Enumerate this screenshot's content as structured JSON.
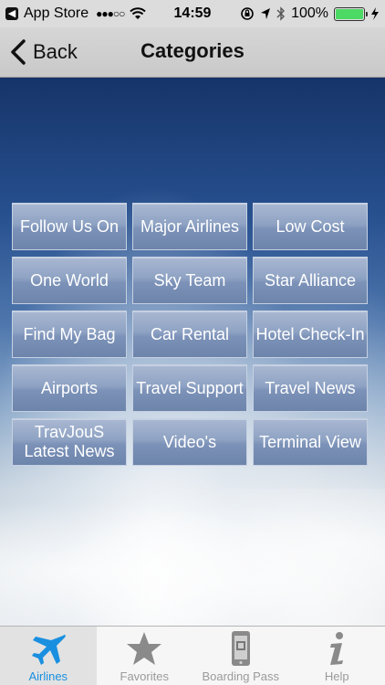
{
  "status_bar": {
    "back_glyph": "◀",
    "carrier": "App Store",
    "signal": "●●●○○",
    "time": "14:59",
    "battery_percent": "100%",
    "battery_level": 1.0,
    "battery_color": "#4cd964"
  },
  "nav": {
    "back_label": "Back",
    "title": "Categories"
  },
  "categories": [
    {
      "label": "Follow Us On"
    },
    {
      "label": "Major Airlines"
    },
    {
      "label": "Low Cost"
    },
    {
      "label": "One World"
    },
    {
      "label": "Sky Team"
    },
    {
      "label": "Star Alliance"
    },
    {
      "label": "Find My Bag"
    },
    {
      "label": "Car Rental"
    },
    {
      "label": "Hotel Check-In"
    },
    {
      "label": "Airports"
    },
    {
      "label": "Travel Support"
    },
    {
      "label": "Travel News"
    },
    {
      "label": "TravJouS\nLatest News"
    },
    {
      "label": "Video's"
    },
    {
      "label": "Terminal View"
    }
  ],
  "tabs": [
    {
      "label": "Airlines",
      "icon": "airplane-icon",
      "active": true
    },
    {
      "label": "Favorites",
      "icon": "star-icon",
      "active": false
    },
    {
      "label": "Boarding Pass",
      "icon": "phone-icon",
      "active": false
    },
    {
      "label": "Help",
      "icon": "info-icon",
      "active": false
    }
  ],
  "colors": {
    "accent": "#1a8fe0",
    "inactive": "#9a9a9a"
  }
}
